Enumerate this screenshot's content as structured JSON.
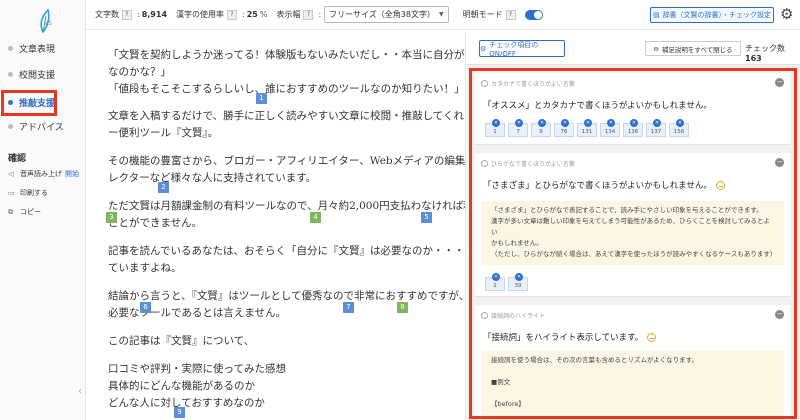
{
  "app": {
    "logo_sub": "VS"
  },
  "sidebar": {
    "items": [
      {
        "label": "文章表現"
      },
      {
        "label": "校閲支援"
      },
      {
        "label": "推敲支援"
      },
      {
        "label": "アドバイス"
      }
    ],
    "section_title": "確認",
    "tools": [
      {
        "label": "音声読み上げ",
        "extra": "開始"
      },
      {
        "label": "印刷する"
      },
      {
        "label": "コピー"
      }
    ]
  },
  "header": {
    "char_count_label": "文字数",
    "char_count": "8,914",
    "kanji_label": "漢字の使用率",
    "kanji_rate": "25",
    "kanji_unit": "%",
    "width_label": "表示幅",
    "width_value": "フリーサイズ（全角38文字）",
    "light_mode_label": "明朝モード",
    "dict_button": "辞書（文賢の辞書）・チェック設定",
    "help": "?"
  },
  "editor": {
    "lines": [
      "「文賢を契約しようか迷ってる！体験版もないみたいだし・・本当に自分が使うべき",
      "なのかな？」",
      "「値段もそこそこするらしいし、誰におすすめのツールなのか知りたい！」",
      "文章を入稿するだけで、勝手に正しく読みやすい文章に校閲・推敲してくれるスーパ",
      "ー便利ツール『文賢』。",
      "その機能の豊富さから、ブロガー・アフィリエイター、Webメディアの編集者・ディ",
      "レクターなど様々な人に支持されています。",
      "ただ文賢は月額課金制の有料ツールなので、月々約2,000円支払わなければ利用する",
      "ことができません。",
      "記事を読んでいるあなたは、おそらく「自分に『文賢』は必要なのか・・・」と迷っ",
      "ていますよね。",
      "結論から言うと、『文賢』はツールとして優秀なので非常におすすめですが、全員に",
      "必要なツールであるとは言えません。",
      "この記事は『文賢』について、",
      "口コミや評判・実際に使ってみた感想",
      "具体的にどんな機能があるのか",
      "どんな人に対しておすすめなのか"
    ],
    "badges": [
      "1",
      "2",
      "3",
      "4",
      "5",
      "6",
      "7",
      "8",
      "9"
    ]
  },
  "panel": {
    "check_toggle": "チェック項目のON/OFF",
    "close_all": "補足説明をすべて閉じる",
    "check_count_label": "チェック数",
    "check_count": "163",
    "cards": [
      {
        "tag": "カタカナで書くほうがよい言葉",
        "title": "「オススメ」とカタカナで書くほうがよいかもしれません。",
        "chips": [
          "1",
          "7",
          "9",
          "76",
          "131",
          "134",
          "136",
          "137",
          "156"
        ]
      },
      {
        "tag": "ひらがなで書くほうがよい言葉",
        "title": "「さまざま」とひらがなで書くほうがよいかもしれません。",
        "note": [
          "「さまざま」とひらがなで表記することで、読み手にやさしい印象を与えることができます。",
          "漢字が多い文章は難しい印象を与えてしまう可能性があるため、ひらくことを検討してみるとよい",
          "かもしれません。",
          "（ただし、ひらがなが続く場合は、あえて漢字を使ったほうが読みやすくなるケースもあります）"
        ],
        "chips": [
          "2",
          "39"
        ]
      },
      {
        "tag": "接続詞のハイライト",
        "title": "「接続詞」をハイライト表示しています。",
        "note": [
          "接続詞を使う場合は、その次の言葉も含めるとリズムがよくなります。",
          "",
          "■例文",
          "",
          "【before】"
        ]
      }
    ]
  },
  "colors": {
    "accent": "#2d6fcf",
    "highlight_frame": "#e8361f",
    "badge_blue": "#5b8fd6",
    "badge_green": "#7db65b"
  }
}
